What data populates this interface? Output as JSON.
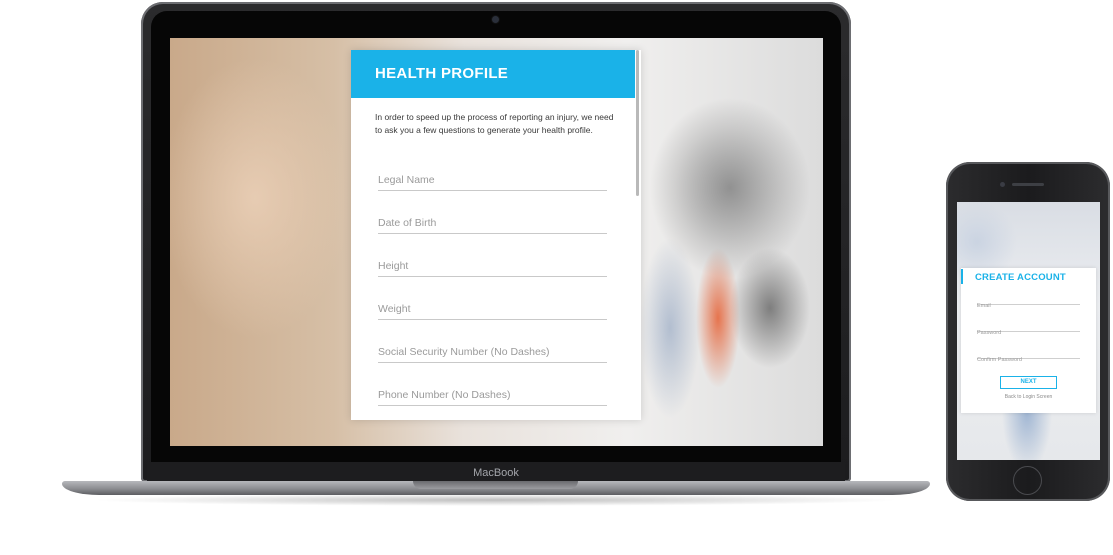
{
  "laptop": {
    "brand_label": "MacBook",
    "health_profile": {
      "title": "HEALTH PROFILE",
      "intro": "In order to speed up the process of reporting an injury, we need to ask you a few questions to generate your health profile.",
      "fields": [
        {
          "placeholder": "Legal Name",
          "value": ""
        },
        {
          "placeholder": "Date of Birth",
          "value": ""
        },
        {
          "placeholder": "Height",
          "value": ""
        },
        {
          "placeholder": "Weight",
          "value": ""
        },
        {
          "placeholder": "Social Security Number (No Dashes)",
          "value": ""
        },
        {
          "placeholder": "Phone Number (No Dashes)",
          "value": ""
        }
      ]
    }
  },
  "phone": {
    "create_account": {
      "title": "CREATE ACCOUNT",
      "fields": [
        {
          "placeholder": "Email",
          "value": ""
        },
        {
          "placeholder": "Password",
          "value": ""
        },
        {
          "placeholder": "Confirm Password",
          "value": ""
        }
      ],
      "next_label": "NEXT",
      "back_link": "Back to Login Screen"
    }
  },
  "colors": {
    "accent": "#1ab2e8",
    "card_background": "#ffffff",
    "device_body": "#1d1d1f"
  }
}
